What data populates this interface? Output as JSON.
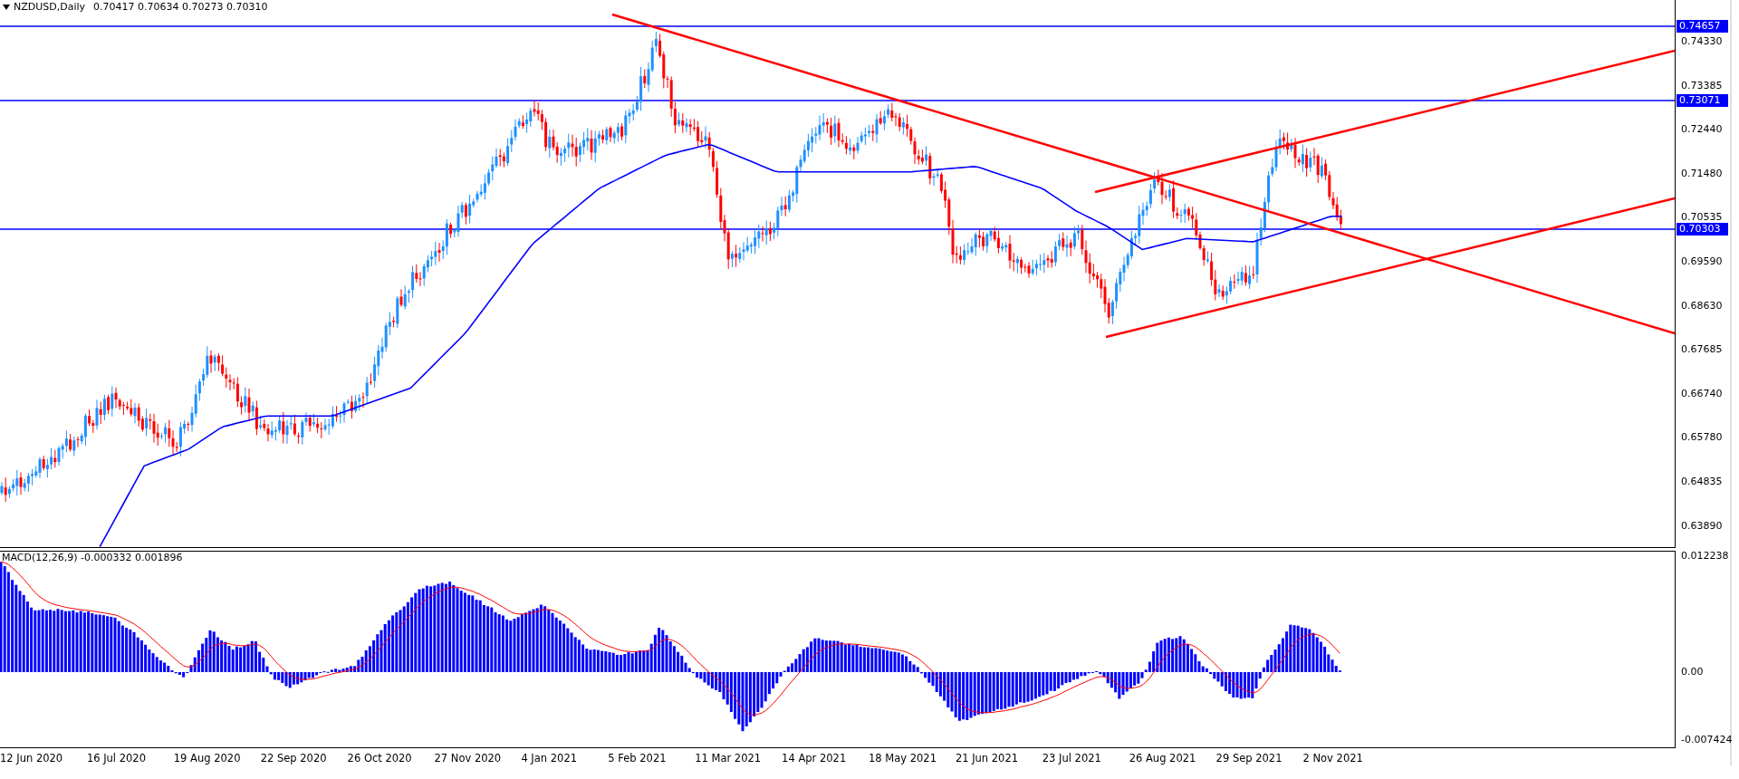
{
  "header": {
    "symbol": "NZDUSD,Daily",
    "values": "0.70417 0.70634 0.70273 0.70310"
  },
  "price_axis": [
    "0.74330",
    "0.73385",
    "0.72440",
    "0.71480",
    "0.70535",
    "0.69590",
    "0.68630",
    "0.67685",
    "0.66740",
    "0.65780",
    "0.64835",
    "0.63890"
  ],
  "level_lines": [
    {
      "label": "0.74657"
    },
    {
      "label": "0.73071"
    },
    {
      "label": "0.70303"
    }
  ],
  "macd": {
    "title": "MACD(12,26,9) -0.000332 0.001896",
    "axis": [
      "0.012238",
      "0.00",
      "-0.007424"
    ]
  },
  "date_axis": [
    "12 Jun 2020",
    "16 Jul 2020",
    "19 Aug 2020",
    "22 Sep 2020",
    "26 Oct 2020",
    "27 Nov 2020",
    "4 Jan 2021",
    "5 Feb 2021",
    "11 Mar 2021",
    "14 Apr 2021",
    "18 May 2021",
    "21 Jun 2021",
    "23 Jul 2021",
    "26 Aug 2021",
    "29 Sep 2021",
    "2 Nov 2021"
  ]
}
